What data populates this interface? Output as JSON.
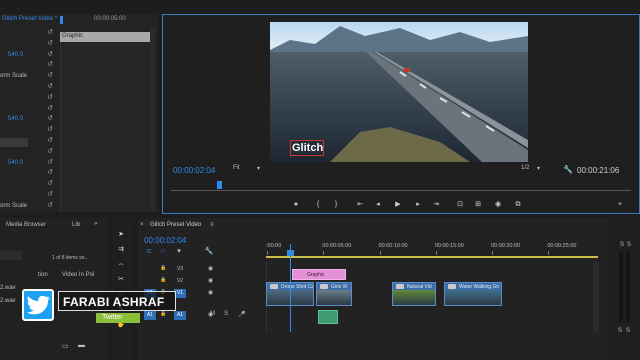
{
  "colors": {
    "accent": "#2d8ceb",
    "playhead": "#2d8ceb",
    "graphic_clip": "#e48fd8",
    "video_clip": "#3b6ea8",
    "audio_clip": "#3e9a72"
  },
  "effect_controls": {
    "sequence_label": "Glitch Preset Video *",
    "timecode": "00:00:05:00",
    "graphic_clip_label": "Graphic",
    "rows": [
      {
        "label": "",
        "value": "",
        "reset": "true"
      },
      {
        "label": "",
        "value": "",
        "reset": "true"
      },
      {
        "label": "",
        "value": "540.0",
        "reset": "true"
      },
      {
        "label": "",
        "value": "",
        "reset": "true"
      },
      {
        "label": "orm Scale",
        "value": "",
        "reset": "true"
      },
      {
        "label": "",
        "value": "",
        "reset": "true"
      },
      {
        "label": "",
        "value": "",
        "reset": "true"
      },
      {
        "label": "",
        "value": "",
        "reset": "true"
      },
      {
        "label": "",
        "value": "540.0",
        "reset": "true"
      },
      {
        "label": "",
        "value": "",
        "reset": "true"
      },
      {
        "label": "",
        "value": "",
        "reset": "true"
      },
      {
        "label": "",
        "value": "",
        "reset": "true"
      },
      {
        "label": "",
        "value": "540.0",
        "reset": "true"
      },
      {
        "label": "",
        "value": "",
        "reset": "true"
      },
      {
        "label": "",
        "value": "",
        "reset": "true"
      },
      {
        "label": "",
        "value": "",
        "reset": "true"
      },
      {
        "label": "orm Scale",
        "value": "",
        "reset": "true"
      }
    ]
  },
  "program_monitor": {
    "overlay_text": "Glitch",
    "current_time": "00:00:02:04",
    "fit_label": "Fit",
    "resolution": "1/2",
    "duration": "00:00:21:06",
    "playhead_fraction": 0.1
  },
  "project_panel": {
    "tabs": [
      "Media Browser",
      "Lib"
    ],
    "item_count": "1 of 8 items se...",
    "columns": [
      "tion",
      "Video In Poi"
    ],
    "files": [
      "2.wav",
      "2.wav"
    ]
  },
  "timeline": {
    "title": "Glitch Preset Video",
    "timecode": "00:00:02:04",
    "ruler": [
      ":00:00",
      "00:00:05:00",
      "00:00:10:00",
      "00:00:15:00",
      "00:00:20:00",
      "00:00:25:00"
    ],
    "tracks": [
      {
        "id": "V3",
        "toggle": ""
      },
      {
        "id": "V2",
        "toggle": ""
      },
      {
        "id": "V1",
        "toggle": "V1"
      },
      {
        "id": "A1",
        "toggle": "A1"
      }
    ],
    "track_buttons": [
      "M",
      "S"
    ],
    "graphic_clip": "Graphic",
    "clips": [
      {
        "name": "Drone Shot Car",
        "color": "#3b6ea8"
      },
      {
        "name": "Girls W",
        "color": "#3b6ea8"
      },
      {
        "name": "Natural Vid",
        "color": "#3b6ea8"
      },
      {
        "name": "Water Walking Gir",
        "color": "#3b6ea8"
      }
    ],
    "meter_labels": [
      "S",
      "S"
    ]
  },
  "watermark": {
    "name": "FARABI ASHRAF",
    "platform": "Twitter"
  }
}
